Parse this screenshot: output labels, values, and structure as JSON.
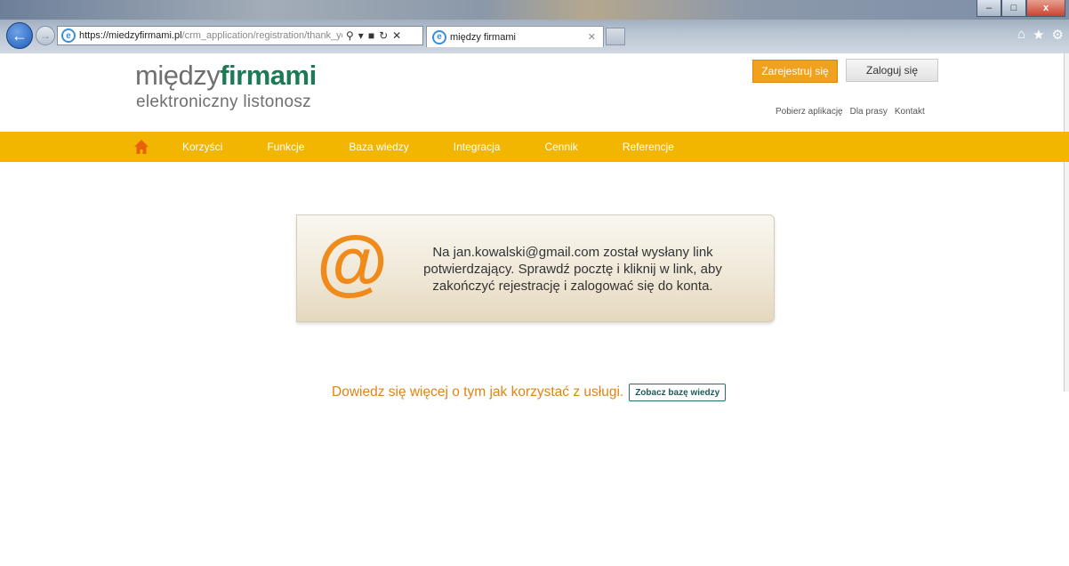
{
  "browser": {
    "url_host": "https://miedzyfirmami.pl",
    "url_path": "/crm_application/registration/thank_yo",
    "tab_title": "między firmami",
    "window_controls": [
      "–",
      "□",
      "x"
    ],
    "icons": [
      "back-icon",
      "forward-icon",
      "search-icon",
      "lock-icon",
      "refresh-icon",
      "stop-icon",
      "home-icon",
      "star-icon",
      "gear-icon"
    ]
  },
  "header": {
    "logo_part1": "między",
    "logo_part2": "firmami",
    "tagline": "elektroniczny listonosz",
    "register_label": "Zarejestruj się",
    "login_label": "Zaloguj się",
    "links": [
      "Pobierz aplikację",
      "Dla prasy",
      "Kontakt"
    ]
  },
  "nav": {
    "items": [
      "Korzyści",
      "Funkcje",
      "Baza wiedzy",
      "Integracja",
      "Cennik",
      "Referencje"
    ]
  },
  "notice": {
    "icon": "@",
    "line1": "Na jan.kowalski@gmail.com został wysłany link",
    "line2": "potwierdzający. Sprawdź pocztę i kliknij w link, aby",
    "line3": "zakończyć rejestrację i zalogować się do konta."
  },
  "learn_more": {
    "text": "Dowiedz się więcej o tym jak korzystać z usługi.",
    "button_label": "Zobacz bazę wiedzy"
  },
  "colors": {
    "accent_orange": "#f0a11e",
    "menu_yellow": "#f2b600",
    "brand_green": "#1d7a56",
    "at_orange": "#ef8a1b"
  }
}
